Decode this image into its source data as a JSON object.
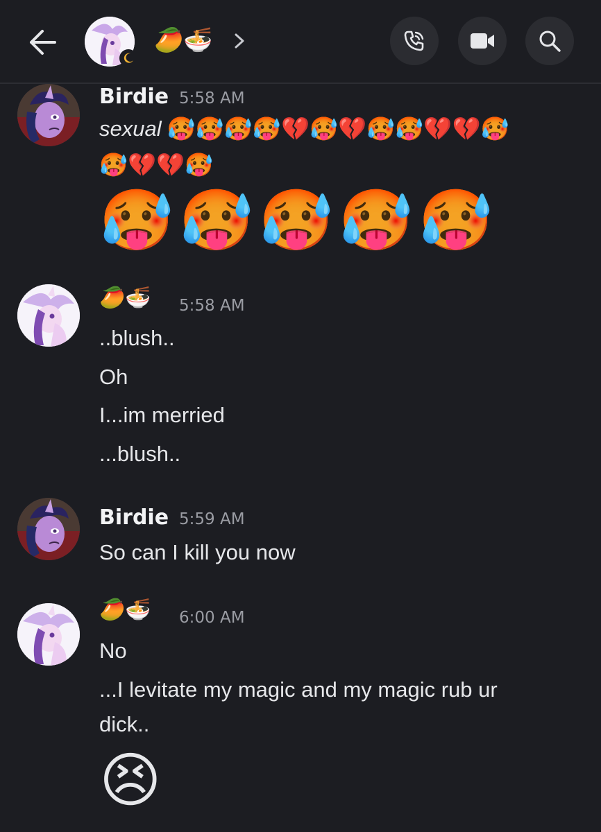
{
  "header": {
    "back_icon": "arrow-left-icon",
    "channel_title": "🥭🍜",
    "chevron": "›",
    "call_icon": "phone-icon",
    "video_icon": "video-camera-icon",
    "search_icon": "search-icon"
  },
  "messages": [
    {
      "author": "Birdie",
      "time": "5:58 AM",
      "italic_text": "sexual",
      "emoji_line1": "🥵🥵🥵🥵💔🥵💔🥵🥵💔💔🥵",
      "emoji_line2": "🥵💔💔🥵",
      "jumbo": [
        "🥵",
        "🥵",
        "🥵",
        "🥵",
        "🥵"
      ]
    },
    {
      "author": "🥭🍜",
      "time": "5:58 AM",
      "lines": [
        "..blush..",
        "Oh",
        "I...im merried",
        "...blush.."
      ]
    },
    {
      "author": "Birdie",
      "time": "5:59 AM",
      "lines": [
        "So can I kill you now"
      ]
    },
    {
      "author": "🥭🍜",
      "time": "6:00 AM",
      "lines": [
        "No",
        "...I levitate  my magic and  my magic  rub ur",
        "dick.."
      ],
      "jumbo": [
        "😣"
      ]
    }
  ],
  "colors": {
    "background": "#1c1d22",
    "button_bg": "#2b2c31",
    "timestamp": "#9a9ca3"
  }
}
